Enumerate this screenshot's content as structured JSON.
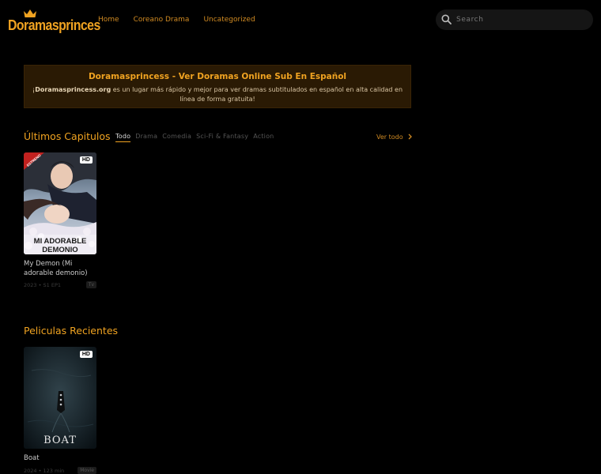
{
  "header": {
    "logo_text": "Doramasprinces",
    "nav": [
      "Home",
      "Coreano Drama",
      "Uncategorized"
    ],
    "search_placeholder": "Search"
  },
  "banner": {
    "title": "Doramasprincess - Ver Doramas Online Sub En Español",
    "desc_prefix": "¡",
    "desc_brand": "Doramasprincess.org",
    "desc_rest": " es un lugar más rápido y mejor para ver dramas subtitulados en español en alta calidad en línea de forma gratuita!"
  },
  "latest": {
    "title": "Últimos Capitulos",
    "tabs": [
      "Todo",
      "Drama",
      "Comedia",
      "Sci-Fi & Fantasy",
      "Action"
    ],
    "view_all": "Ver todo",
    "items": [
      {
        "quality": "HD",
        "poster_text_1": "MI ADORABLE",
        "poster_text_2": "DEMONIO",
        "ribbon": "ESTRENO",
        "title": "My Demon (Mi adorable demonio)",
        "year": "2023",
        "episode": "S1 EP1",
        "type": "Tv"
      }
    ]
  },
  "movies": {
    "title": "Peliculas Recientes",
    "items": [
      {
        "quality": "HD",
        "poster_text": "BOAT",
        "title": "Boat",
        "year": "2024",
        "duration": "123 min",
        "type": "Movie"
      }
    ]
  },
  "colors": {
    "accent": "#f0a321",
    "background": "#000000",
    "banner_bg": "#2a1a04"
  }
}
